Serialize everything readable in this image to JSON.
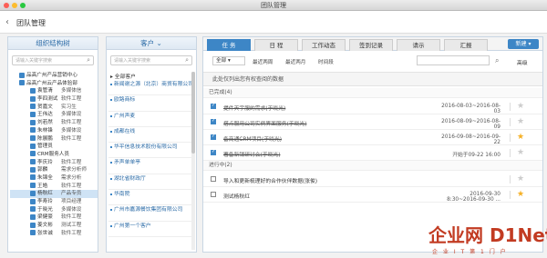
{
  "window": {
    "title": "团队管理"
  },
  "header": {
    "title": "团队管理",
    "back_icon": "chevron-left-icon"
  },
  "org": {
    "title": "组织结构树",
    "search_placeholder": "请输入关键字搜索",
    "rows": [
      {
        "c1": "品高广州产品营销中心",
        "c2": "",
        "level": 0
      },
      {
        "c1": "品高广州云产品体验部",
        "c2": "",
        "level": 0
      },
      {
        "c1": "袁管清",
        "c2": "多媒体信",
        "level": 1
      },
      {
        "c1": "李四测试",
        "c2": "软件工程",
        "level": 1
      },
      {
        "c1": "贺嘉文",
        "c2": "实习生",
        "level": 1
      },
      {
        "c1": "王伟达",
        "c2": "多媒体设",
        "level": 1
      },
      {
        "c1": "刘若然",
        "c2": "软件工程",
        "level": 1
      },
      {
        "c1": "朱林锋",
        "c2": "多媒体设",
        "level": 1
      },
      {
        "c1": "陈展鹏",
        "c2": "软件工程",
        "level": 1
      },
      {
        "c1": "管理员",
        "c2": "",
        "level": 1
      },
      {
        "c1": "CRM服务人员",
        "c2": "",
        "level": 1
      },
      {
        "c1": "李庆玲",
        "c2": "软件工程",
        "level": 1
      },
      {
        "c1": "郭麟",
        "c2": "需求分析师",
        "level": 1
      },
      {
        "c1": "朱锦全",
        "c2": "需求分析",
        "level": 1
      },
      {
        "c1": "王皓",
        "c2": "软件工程",
        "level": 1
      },
      {
        "c1": "杨秋红",
        "c2": "产品专员",
        "level": 1,
        "selected": true
      },
      {
        "c1": "李寿玲",
        "c2": "项目经理",
        "level": 1
      },
      {
        "c1": "于晓光",
        "c2": "多媒体设",
        "level": 1
      },
      {
        "c1": "梁健豪",
        "c2": "软件工程",
        "level": 1
      },
      {
        "c1": "姜文彬",
        "c2": "测试工程",
        "level": 1
      },
      {
        "c1": "张世诚",
        "c2": "软件工程",
        "level": 1
      }
    ]
  },
  "customers": {
    "title": "客户",
    "search_placeholder": "请输入关键字搜索",
    "all_label": "全部客户",
    "items": [
      "新闻谢之源（北京）商贸有限公司",
      "欧路商标",
      "广州声麦",
      "成都在线",
      "华平信息技术股份有限公司",
      "矛声单单亭",
      "湖北省财政厅",
      "华南院",
      "广州市嘉源餐饮集团有限公司",
      "广州第一个客户"
    ]
  },
  "tabs": [
    "任 务",
    "日 程",
    "工作动态",
    "签到记录",
    "请示",
    "汇报"
  ],
  "new_button": "新建 ▾",
  "filter": {
    "select": "全部",
    "links": [
      "最近两周",
      "最近两月",
      "时间段"
    ],
    "advanced": "高级"
  },
  "notice": "此处仅列出您有权查阅的数据",
  "groups": [
    {
      "label": "已完成(4)",
      "tasks": [
        {
          "name": "提件天宇服的需求(于晓光)",
          "date": "2016-08-03~2016-08-03",
          "done": true,
          "star": false
        },
        {
          "name": "搭点服用公司实例界面服务(于晓光)",
          "date": "2016-08-09~2016-08-09",
          "done": true,
          "star": false
        },
        {
          "name": "备商通CRM项目(于晓光)",
          "date": "2016-09-08~2016-09-22",
          "done": true,
          "star": true
        },
        {
          "name": "署备新销研讨会(于晓光)",
          "date": "开始于09-22 16:00",
          "done": true,
          "star": false
        }
      ]
    },
    {
      "label": "进行中(2)",
      "tasks": [
        {
          "name": "导入和更新梳理好的合作伙伴数据(张俊)",
          "date": "",
          "done": false,
          "star": false
        },
        {
          "name": "测试杨秋红",
          "date": "2016-09-30 8:30~2016-09-30 ...",
          "done": false,
          "star": true
        }
      ]
    }
  ],
  "watermark": {
    "brand": "企业网 D1Net",
    "slogan": "企 业 I T 第 1 门 户"
  },
  "colors": {
    "accent": "#3d86c6",
    "star": "#f5b025",
    "watermark": "#c23b22"
  }
}
